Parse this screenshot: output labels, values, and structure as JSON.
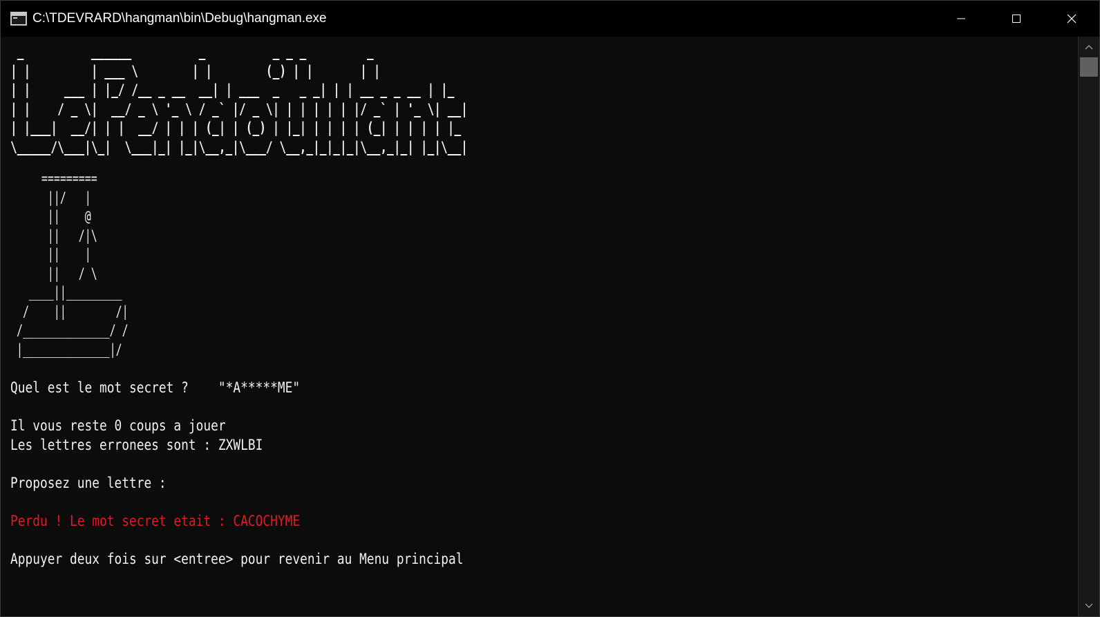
{
  "window": {
    "title": "C:\\TDEVRARD\\hangman\\bin\\Debug\\hangman.exe",
    "controls": {
      "minimize": "minimize-icon",
      "maximize": "maximize-icon",
      "close": "close-icon"
    }
  },
  "console": {
    "logo_ascii": " _          ______          _          _ _ _         _   \n| |         | ___ \\        | |        (_) | |       | |  \n| |     ___ | |_/ /__ _ __  __| | ___  _   _ _| | | __ _ _ __ | |_ \n| |    / _ \\|  __/ _ \\ '_ \\ / _` |/ _ \\| | | | | | |/ _` | '_ \\| __|\n| |___|  __/| | |  __/ | | | (_| | (_) | |_| | | | | (_| | | | | |_ \n\\_____/\\___|\\_|  \\___|_| |_|\\__,_|\\___/ \\__,_|_|_|_|\\__,_|_| |_|\\__|",
    "gallows_ascii": "     =========\n      ||/   |\n      ||    @\n      ||   /|\\\n      ||    |\n      ||   / \\\n   ____||_________\n  /    ||        /|\n /______________/ /\n |______________|/",
    "secret_prompt": "Quel est le mot secret ?    \"*A*****ME\"",
    "remaining": "Il vous reste 0 coups a jouer",
    "wrong_letters": "Les lettres erronees sont : ZXWLBI",
    "propose": "Proposez une lettre :",
    "lost_message": "Perdu ! Le mot secret etait : CACOCHYME",
    "return_prompt": "Appuyer deux fois sur <entree> pour revenir au Menu principal"
  },
  "colors": {
    "background": "#0c0c0c",
    "text": "#f2f2f2",
    "logo": "#3a96dd",
    "error": "#e01b24"
  }
}
